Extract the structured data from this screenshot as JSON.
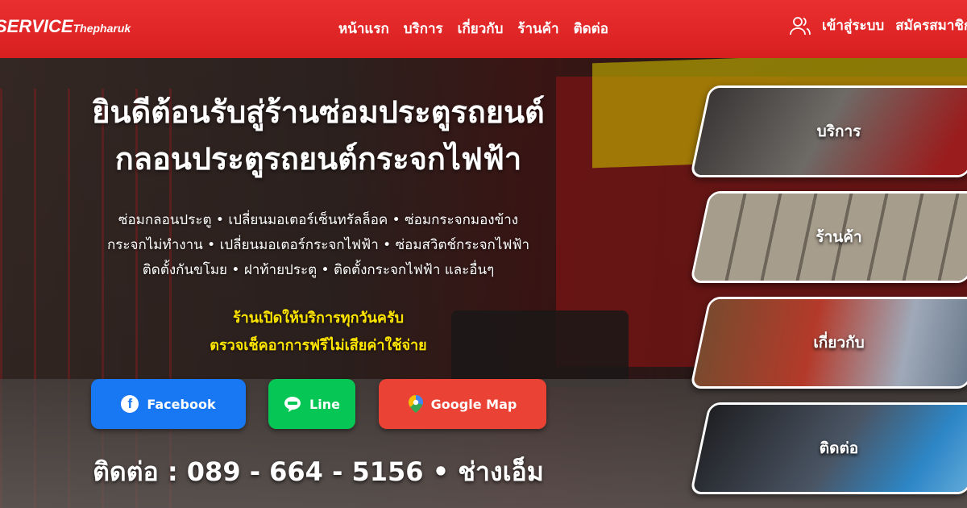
{
  "header": {
    "logo_main": "SERVICE",
    "logo_sub": "Thepharuk",
    "nav": [
      "หน้าแรก",
      "บริการ",
      "เกี่ยวกับ",
      "ร้านค้า",
      "ติดต่อ"
    ],
    "login_label": "เข้าสู่ระบบ",
    "register_label": "สมัครสมาชิก"
  },
  "hero": {
    "headline_line1": "ยินดีต้อนรับสู่ร้านซ่อมประตูรถยนต์",
    "headline_line2": "กลอนประตูรถยนต์กระจกไฟฟ้า",
    "services_line1": "ซ่อมกลอนประตู • เปลี่ยนมอเตอร์เซ็นทรัลล็อค • ซ่อมกระจกมองข้าง",
    "services_line2": "กระจกไม่ทำงาน • เปลี่ยนมอเตอร์กระจกไฟฟ้า • ซ่อมสวิตช์กระจกไฟฟ้า",
    "services_line3": "ติดตั้งกันขโมย • ฝาท้ายประตู • ติดตั้งกระจกไฟฟ้า และอื่นๆ",
    "promo_line1": "ร้านเปิดให้บริการทุกวันครับ",
    "promo_line2": "ตรวจเช็คอาการฟรีไม่เสียค่าใช้จ่าย",
    "contact_line": "ติดต่อ : 089 - 664 - 5156 • ช่างเอ็ม"
  },
  "buttons": {
    "facebook": "Facebook",
    "line": "Line",
    "google_map": "Google Map"
  },
  "cards": [
    "บริการ",
    "ร้านค้า",
    "เกี่ยวกับ",
    "ติดต่อ"
  ],
  "colors": {
    "nav_red": "#e02828",
    "facebook_blue": "#1877f2",
    "line_green": "#06c755",
    "map_red": "#ea4335",
    "promo_yellow": "#ffe600"
  }
}
